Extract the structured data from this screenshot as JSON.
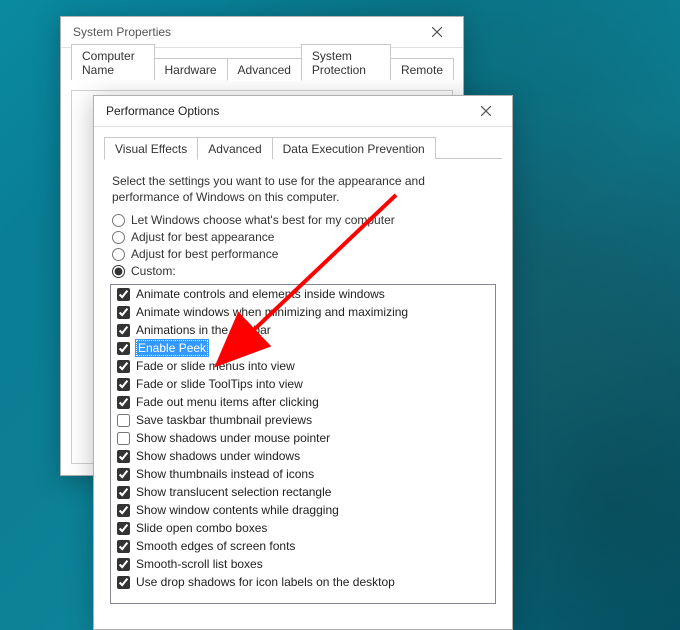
{
  "sysProps": {
    "title": "System Properties",
    "tabs": [
      "Computer Name",
      "Hardware",
      "Advanced",
      "System Protection",
      "Remote"
    ],
    "activeTab": "Advanced"
  },
  "perfOpts": {
    "title": "Performance Options",
    "tabs": [
      "Visual Effects",
      "Advanced",
      "Data Execution Prevention"
    ],
    "activeTab": "Visual Effects",
    "description": "Select the settings you want to use for the appearance and performance of Windows on this computer.",
    "radios": [
      {
        "id": "best-windows",
        "label": "Let Windows choose what's best for my computer",
        "checked": false
      },
      {
        "id": "best-appearance",
        "label": "Adjust for best appearance",
        "checked": false
      },
      {
        "id": "best-performance",
        "label": "Adjust for best performance",
        "checked": false
      },
      {
        "id": "custom",
        "label": "Custom:",
        "checked": true
      }
    ],
    "effects": [
      {
        "label": "Animate controls and elements inside windows",
        "checked": true
      },
      {
        "label": "Animate windows when minimizing and maximizing",
        "checked": true
      },
      {
        "label": "Animations in the taskbar",
        "checked": true
      },
      {
        "label": "Enable Peek",
        "checked": true,
        "highlighted": true
      },
      {
        "label": "Fade or slide menus into view",
        "checked": true
      },
      {
        "label": "Fade or slide ToolTips into view",
        "checked": true
      },
      {
        "label": "Fade out menu items after clicking",
        "checked": true
      },
      {
        "label": "Save taskbar thumbnail previews",
        "checked": false
      },
      {
        "label": "Show shadows under mouse pointer",
        "checked": false
      },
      {
        "label": "Show shadows under windows",
        "checked": true
      },
      {
        "label": "Show thumbnails instead of icons",
        "checked": true
      },
      {
        "label": "Show translucent selection rectangle",
        "checked": true
      },
      {
        "label": "Show window contents while dragging",
        "checked": true
      },
      {
        "label": "Slide open combo boxes",
        "checked": true
      },
      {
        "label": "Smooth edges of screen fonts",
        "checked": true
      },
      {
        "label": "Smooth-scroll list boxes",
        "checked": true
      },
      {
        "label": "Use drop shadows for icon labels on the desktop",
        "checked": true
      }
    ]
  },
  "arrow": {
    "color": "#ff0000"
  }
}
